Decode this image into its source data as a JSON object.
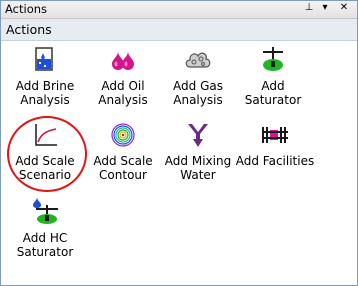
{
  "window": {
    "title": "Actions",
    "pin_glyph": "⊥",
    "dropdown_glyph": "▾",
    "close_glyph": "✕"
  },
  "section": {
    "title": "Actions"
  },
  "items": [
    {
      "label_line1": "Add Brine",
      "label_line2": "Analysis",
      "icon": "brine-flask-icon"
    },
    {
      "label_line1": "Add Oil",
      "label_line2": "Analysis",
      "icon": "oil-drops-icon"
    },
    {
      "label_line1": "Add Gas",
      "label_line2": "Analysis",
      "icon": "gas-cloud-icon"
    },
    {
      "label_line1": "Add",
      "label_line2": "Saturator",
      "icon": "saturator-icon"
    },
    {
      "label_line1": "Add Scale",
      "label_line2": "Scenario",
      "icon": "scale-scenario-curve-icon"
    },
    {
      "label_line1": "Add Scale",
      "label_line2": "Contour",
      "icon": "scale-contour-icon"
    },
    {
      "label_line1": "Add Mixing",
      "label_line2": "Water",
      "icon": "mixing-water-arrows-icon"
    },
    {
      "label_line1": "Add Facilities",
      "label_line2": "",
      "icon": "facilities-icon"
    },
    {
      "label_line1": "Add HC",
      "label_line2": "Saturator",
      "icon": "hc-saturator-icon"
    }
  ],
  "colors": {
    "highlight_ring": "#e01414",
    "accent_blue": "#1f4fd8",
    "oil_magenta": "#d4148c",
    "saturator_green": "#22b422",
    "mixing_purple": "#6a2a8a"
  }
}
